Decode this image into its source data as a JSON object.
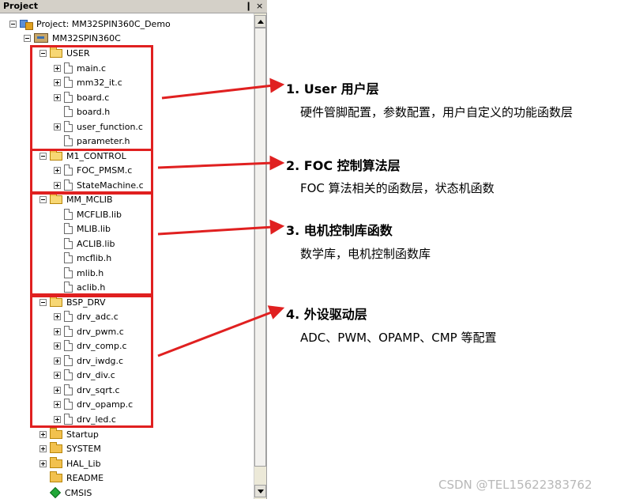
{
  "panel": {
    "title": "Project",
    "pin_label": "❙",
    "close_label": "×"
  },
  "tree": {
    "project": "Project: MM32SPIN360C_Demo",
    "target": "MM32SPIN360C",
    "groups": [
      {
        "name": "USER",
        "files": [
          "main.c",
          "mm32_it.c",
          "board.c",
          "board.h",
          "user_function.c",
          "parameter.h"
        ]
      },
      {
        "name": "M1_CONTROL",
        "files": [
          "FOC_PMSM.c",
          "StateMachine.c"
        ]
      },
      {
        "name": "MM_MCLIB",
        "files": [
          "MCFLIB.lib",
          "MLIB.lib",
          "ACLIB.lib",
          "mcflib.h",
          "mlib.h",
          "aclib.h"
        ]
      },
      {
        "name": "BSP_DRV",
        "files": [
          "drv_adc.c",
          "drv_pwm.c",
          "drv_comp.c",
          "drv_iwdg.c",
          "drv_div.c",
          "drv_sqrt.c",
          "drv_opamp.c",
          "drv_led.c"
        ]
      }
    ],
    "collapsed": [
      "Startup",
      "SYSTEM",
      "HAL_Lib",
      "README",
      "CMSIS"
    ]
  },
  "annotations": [
    {
      "title": "1. User 用户层",
      "desc": "硬件管脚配置，参数配置，用户自定义的功能函数层"
    },
    {
      "title": "2. FOC 控制算法层",
      "desc": "FOC 算法相关的函数层，状态机函数"
    },
    {
      "title": "3. 电机控制库函数",
      "desc": "数学库，电机控制函数库"
    },
    {
      "title": "4. 外设驱动层",
      "desc": "ADC、PWM、OPAMP、CMP 等配置"
    }
  ],
  "watermark": "CSDN @TEL15622383762",
  "colors": {
    "highlight": "#e02020",
    "folder": "#f2c14e",
    "panel_title_bg": "#d4d0c8"
  }
}
